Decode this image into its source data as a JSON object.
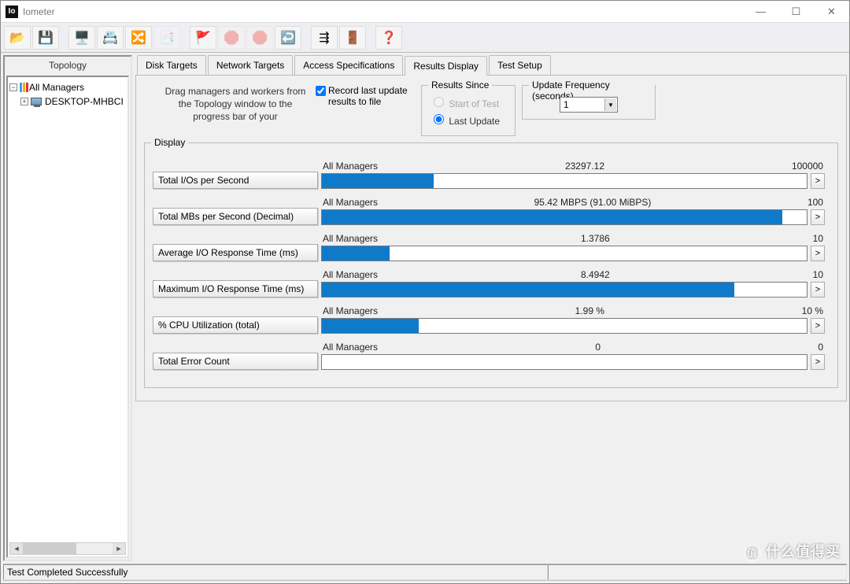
{
  "window": {
    "title": "Iometer",
    "icon_text": "Io"
  },
  "topology": {
    "panel_title": "Topology",
    "root": "All Managers",
    "node": "DESKTOP-MHBCI"
  },
  "tabs": [
    "Disk Targets",
    "Network Targets",
    "Access Specifications",
    "Results Display",
    "Test Setup"
  ],
  "instructions": {
    "drag_text": "Drag managers and workers from the Topology window to the progress bar of your",
    "record_label": "Record last update results to file",
    "results_since_legend": "Results Since",
    "rs_start": "Start of Test",
    "rs_last": "Last Update",
    "update_freq_legend": "Update Frequency (seconds)",
    "update_freq_value": "1"
  },
  "display_legend": "Display",
  "metrics": [
    {
      "name": "Total I/Os per Second",
      "scope": "All Managers",
      "value": "23297.12",
      "max": "100000",
      "fill": 23
    },
    {
      "name": "Total MBs per Second (Decimal)",
      "scope": "All Managers",
      "value": "95.42 MBPS (91.00 MiBPS)",
      "max": "100",
      "fill": 95
    },
    {
      "name": "Average I/O Response Time (ms)",
      "scope": "All Managers",
      "value": "1.3786",
      "max": "10",
      "fill": 14
    },
    {
      "name": "Maximum I/O Response Time (ms)",
      "scope": "All Managers",
      "value": "8.4942",
      "max": "10",
      "fill": 85
    },
    {
      "name": "% CPU Utilization (total)",
      "scope": "All Managers",
      "value": "1.99 %",
      "max": "10 %",
      "fill": 20
    },
    {
      "name": "Total Error Count",
      "scope": "All Managers",
      "value": "0",
      "max": "0",
      "fill": 0
    }
  ],
  "status": "Test Completed Successfully",
  "watermark": "什么值得买"
}
